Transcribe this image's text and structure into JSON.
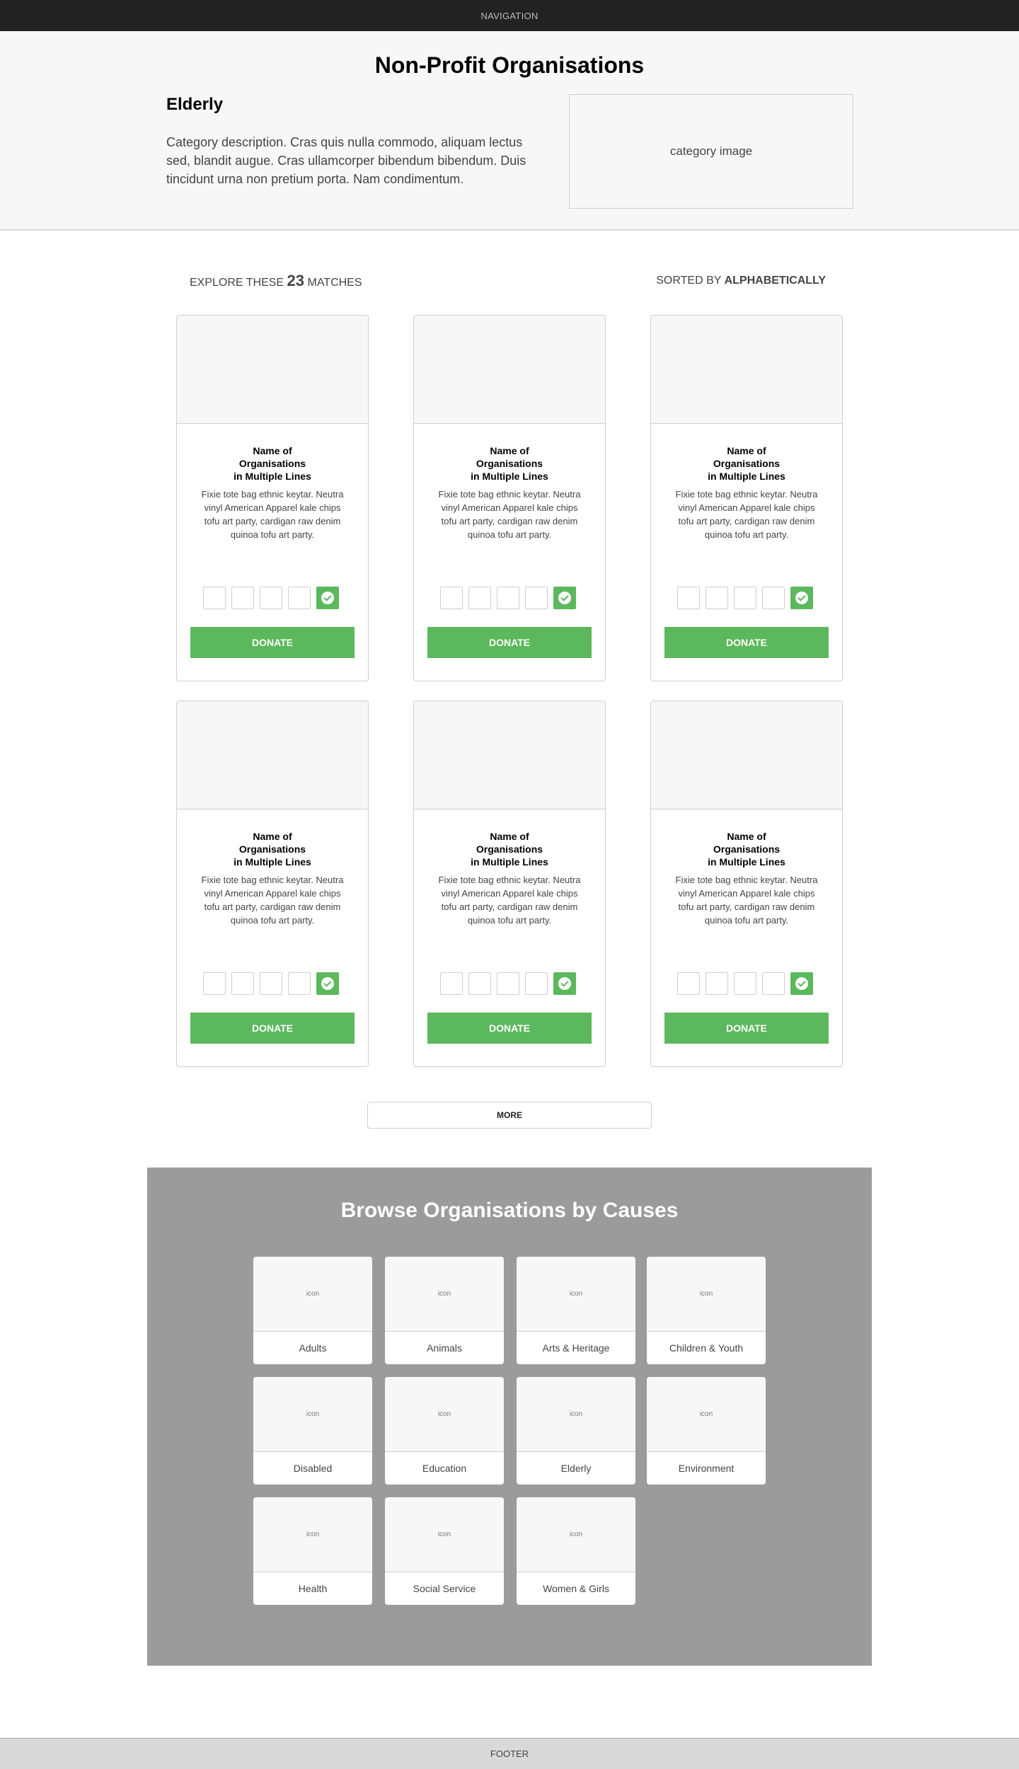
{
  "nav": {
    "label": "NAVIGATION"
  },
  "hero": {
    "title": "Non-Profit Organisations",
    "category_name": "Elderly",
    "category_description": "Category description. Cras quis nulla commodo, aliquam lectus sed, blandit augue. Cras ullamcorper bibendum bibendum. Duis tincidunt urna non pretium porta. Nam condimentum.",
    "category_image_label": "category image"
  },
  "results": {
    "explore_prefix": "EXPLORE THESE",
    "count": "23",
    "explore_suffix": "MATCHES",
    "sorted_prefix": "SORTED BY",
    "sorted_value": "ALPHABETICALLY"
  },
  "cards": [
    {
      "name_line1": "Name of Organisations",
      "name_line2": "in Multiple Lines",
      "description": "Fixie tote bag ethnic keytar. Neutra vinyl American Apparel kale chips tofu art party, cardigan raw denim quinoa tofu art party.",
      "donate_label": "DONATE"
    },
    {
      "name_line1": "Name of Organisations",
      "name_line2": "in Multiple Lines",
      "description": "Fixie tote bag ethnic keytar. Neutra vinyl American Apparel kale chips tofu art party, cardigan raw denim quinoa tofu art party.",
      "donate_label": "DONATE"
    },
    {
      "name_line1": "Name of Organisations",
      "name_line2": "in Multiple Lines",
      "description": "Fixie tote bag ethnic keytar. Neutra vinyl American Apparel kale chips tofu art party, cardigan raw denim quinoa tofu art party.",
      "donate_label": "DONATE"
    },
    {
      "name_line1": "Name of Organisations",
      "name_line2": "in Multiple Lines",
      "description": "Fixie tote bag ethnic keytar. Neutra vinyl American Apparel kale chips tofu art party, cardigan raw denim quinoa tofu art party.",
      "donate_label": "DONATE"
    },
    {
      "name_line1": "Name of Organisations",
      "name_line2": "in Multiple Lines",
      "description": "Fixie tote bag ethnic keytar. Neutra vinyl American Apparel kale chips tofu art party, cardigan raw denim quinoa tofu art party.",
      "donate_label": "DONATE"
    },
    {
      "name_line1": "Name of Organisations",
      "name_line2": "in Multiple Lines",
      "description": "Fixie tote bag ethnic keytar. Neutra vinyl American Apparel kale chips tofu art party, cardigan raw denim quinoa tofu art party.",
      "donate_label": "DONATE"
    }
  ],
  "more_label": "MORE",
  "browse": {
    "title": "Browse Organisations by Causes",
    "icon_placeholder": "icon",
    "causes": [
      {
        "label": "Adults"
      },
      {
        "label": "Animals"
      },
      {
        "label": "Arts & Heritage"
      },
      {
        "label": "Children & Youth"
      },
      {
        "label": "Disabled"
      },
      {
        "label": "Education"
      },
      {
        "label": "Elderly"
      },
      {
        "label": "Environment"
      },
      {
        "label": "Health"
      },
      {
        "label": "Social Service"
      },
      {
        "label": "Women & Girls"
      }
    ]
  },
  "footer": {
    "label": "FOOTER"
  },
  "colors": {
    "accent": "#5cb85c",
    "nav_bg": "#222222",
    "browse_bg": "#9b9b9b",
    "footer_bg": "#d9d9d9"
  }
}
